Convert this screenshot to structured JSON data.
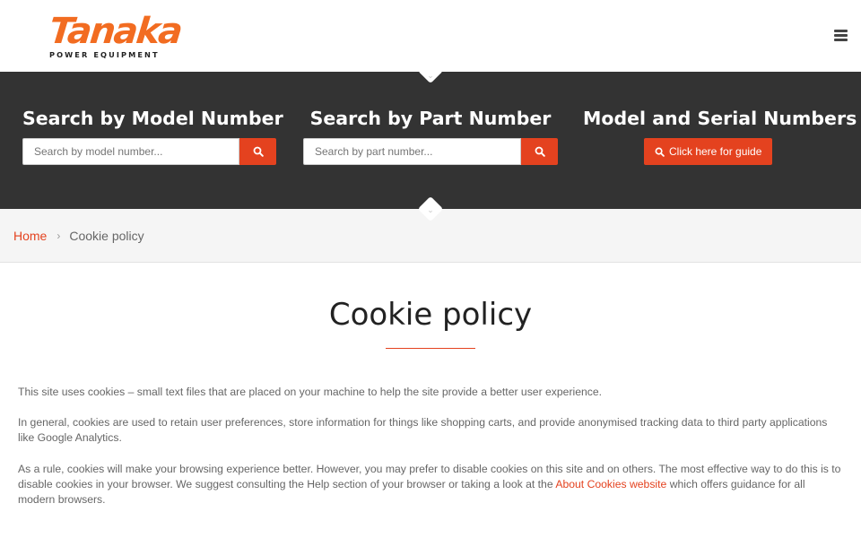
{
  "brand": {
    "logo_text": "Tanaka",
    "logo_subtitle": "POWER EQUIPMENT",
    "logo_mark": "®",
    "accent_color": "#e4421f",
    "logo_color": "#f26c21"
  },
  "header": {
    "menu_icon": "hamburger-menu-icon"
  },
  "search": {
    "model": {
      "title": "Search by Model Number",
      "placeholder": "Search by model number...",
      "button_icon": "search-icon"
    },
    "part": {
      "title": "Search by Part Number",
      "placeholder": "Search by part number...",
      "button_icon": "search-icon"
    },
    "serial": {
      "title": "Model and Serial Numbers",
      "button_label": "Click here for guide",
      "button_icon": "search-icon"
    }
  },
  "breadcrumb": {
    "home": "Home",
    "separator_icon": "chevron-right-icon",
    "current": "Cookie policy"
  },
  "page": {
    "title": "Cookie policy",
    "paragraphs": {
      "p1": "This site uses cookies – small text files that are placed on your machine to help the site provide a better user experience.",
      "p2": "In general, cookies are used to retain user preferences, store information for things like shopping carts, and provide anonymised tracking data to third party applications like Google Analytics.",
      "p3_before": "As a rule, cookies will make your browsing experience better. However, you may prefer to disable cookies on this site and on others. The most effective way to do this is to disable cookies in your browser. We suggest consulting the Help section of your browser or taking a look at the ",
      "p3_link": "About Cookies website",
      "p3_after": " which offers guidance for all modern browsers."
    }
  }
}
